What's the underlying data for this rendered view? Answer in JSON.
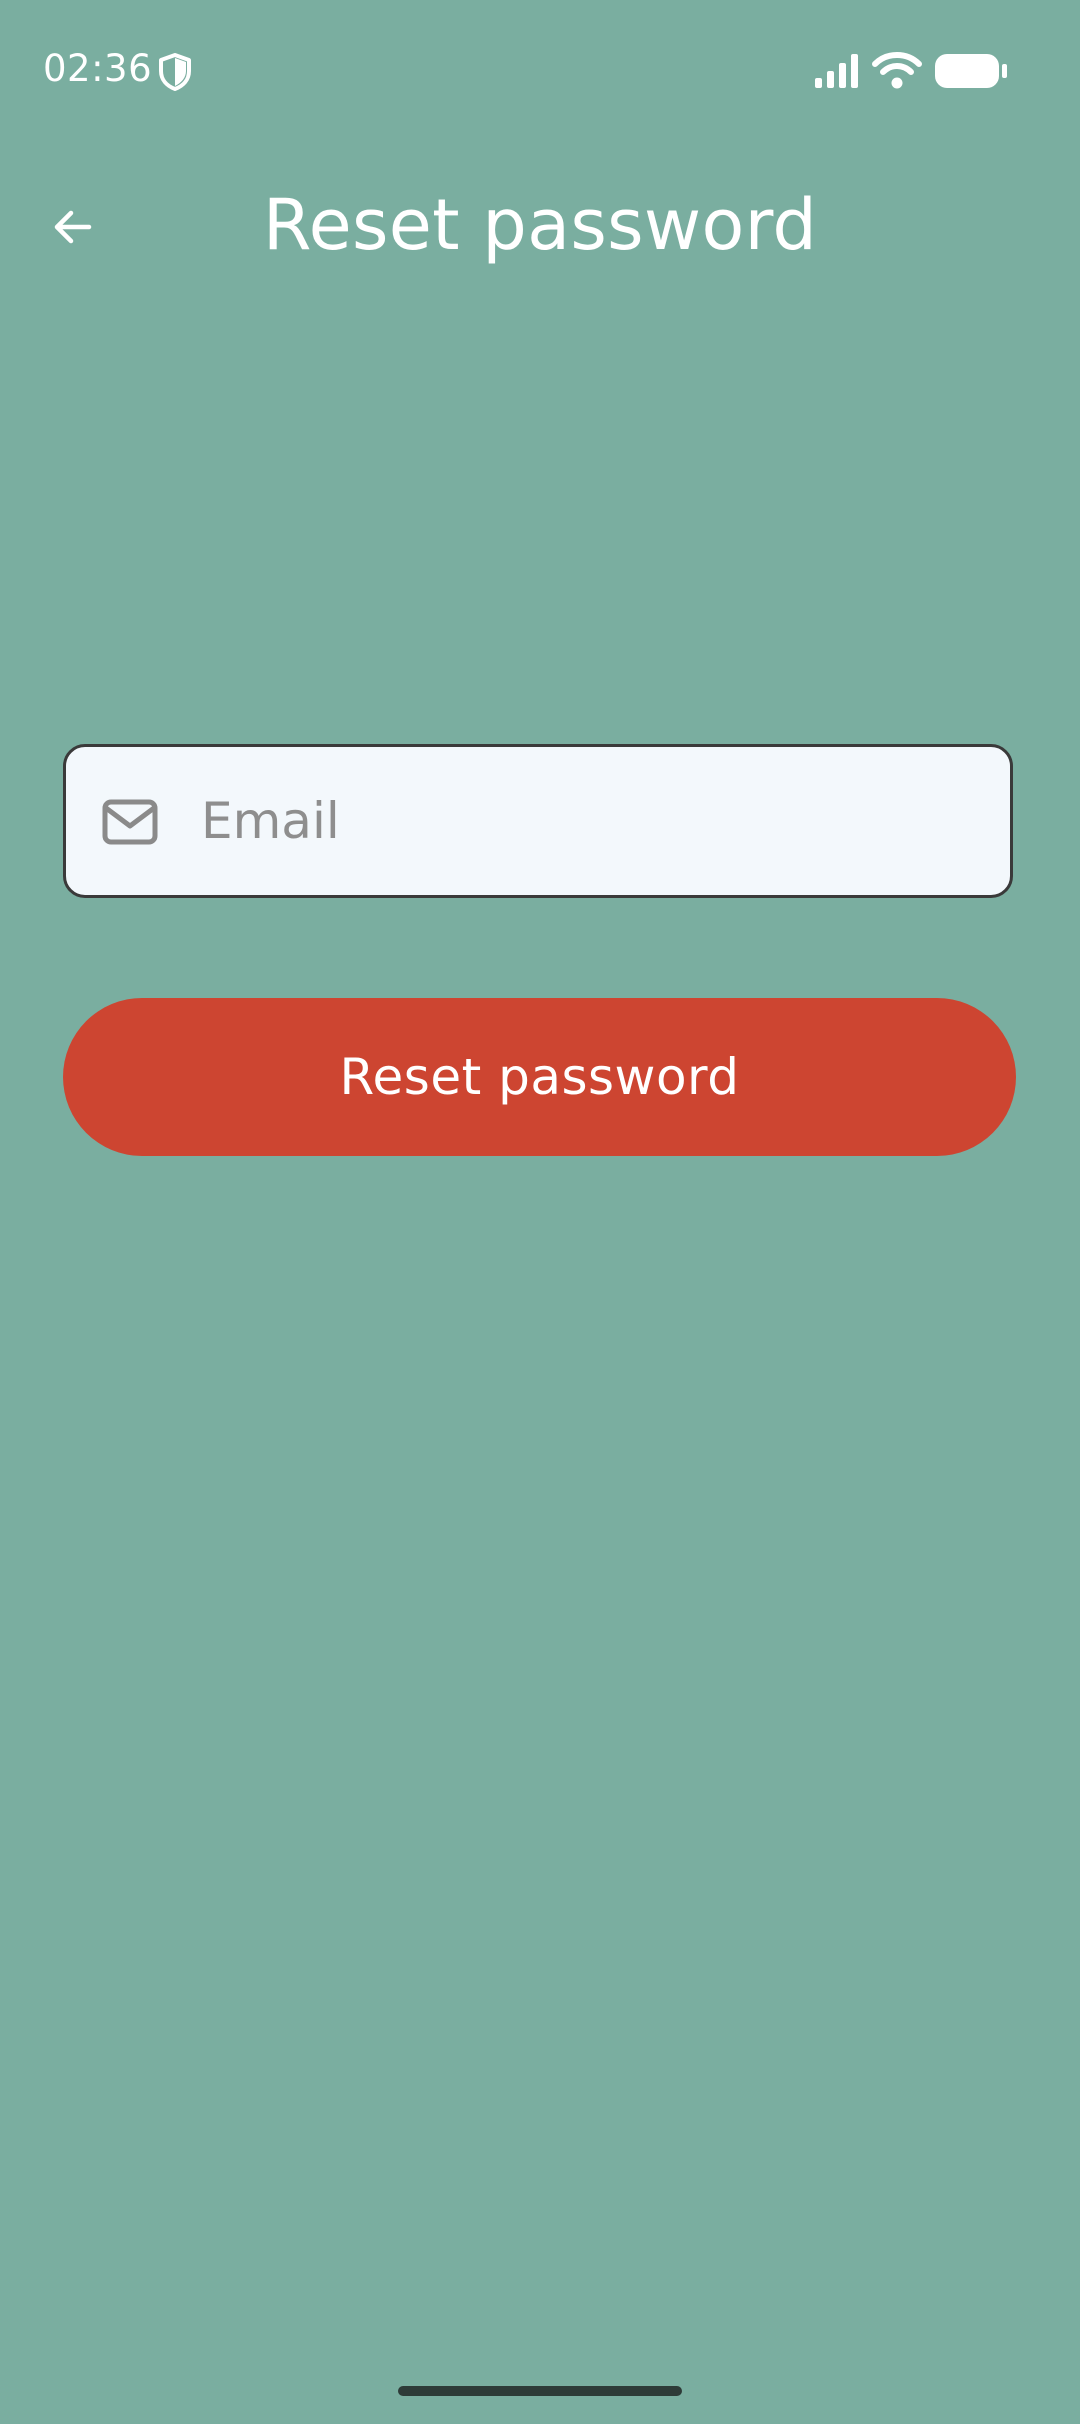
{
  "status_bar": {
    "time": "02:36",
    "icons": [
      "shield-icon",
      "signal-icon",
      "wifi-icon",
      "battery-icon"
    ]
  },
  "app_bar": {
    "title": "Reset password",
    "back_icon": "arrow-left-icon"
  },
  "form": {
    "email": {
      "placeholder": "Email",
      "value": "",
      "icon": "mail-icon"
    },
    "submit_label": "Reset password"
  },
  "colors": {
    "background": "#7aaea0",
    "button": "#cd4531",
    "field_background": "#f3f8fc",
    "text": "#ffffff"
  }
}
